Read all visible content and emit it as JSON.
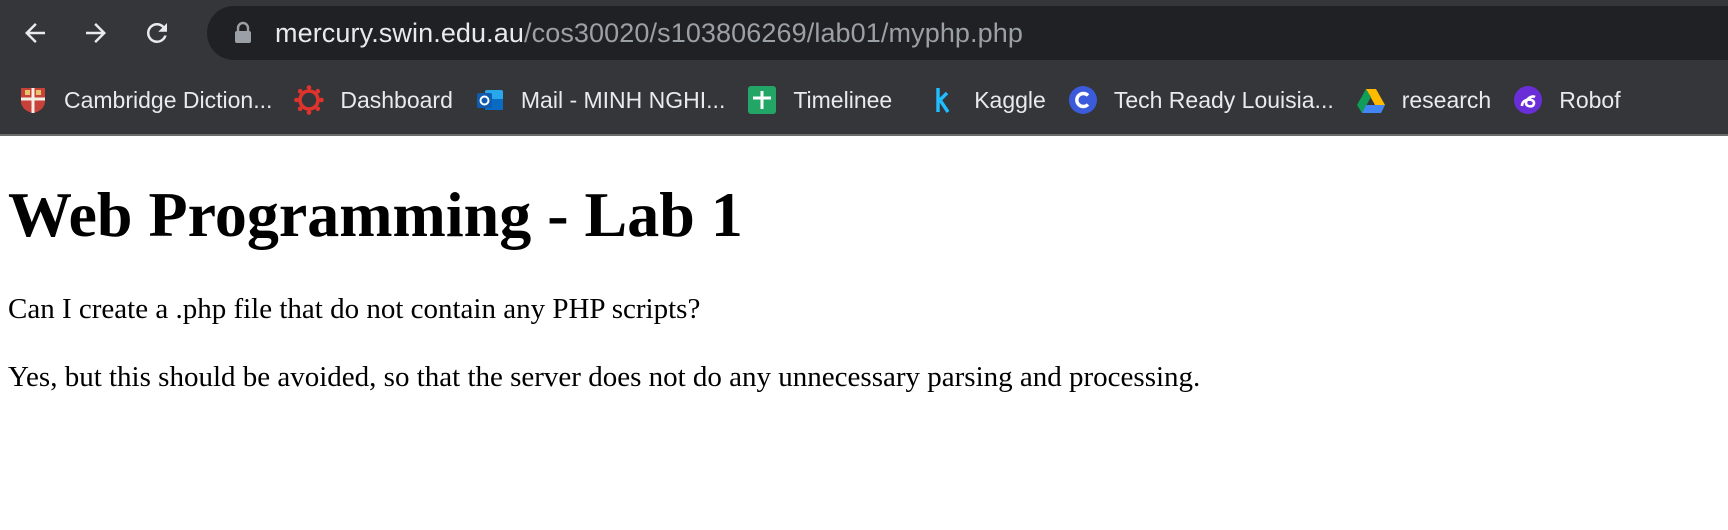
{
  "browser": {
    "url_host": "mercury.swin.edu.au",
    "url_path": "/cos30020/s103806269/lab01/myphp.php"
  },
  "bookmarks": [
    {
      "label": "Cambridge Diction...",
      "icon": "cambridge-crest-icon"
    },
    {
      "label": "Dashboard",
      "icon": "canvas-icon"
    },
    {
      "label": "Mail - MINH NGHI...",
      "icon": "outlook-icon"
    },
    {
      "label": "Timelinee",
      "icon": "google-sheets-icon"
    },
    {
      "label": "Kaggle",
      "icon": "kaggle-icon"
    },
    {
      "label": "Tech Ready Louisia...",
      "icon": "coursera-icon"
    },
    {
      "label": "research",
      "icon": "google-drive-icon"
    },
    {
      "label": "Robof",
      "icon": "roboflow-icon"
    }
  ],
  "page": {
    "heading": "Web Programming - Lab 1",
    "question": "Can I create a .php file that do not contain any PHP scripts?",
    "answer": "Yes, but this should be avoided, so that the server does not do any unnecessary parsing and processing."
  },
  "colors": {
    "chrome_bg": "#35363a",
    "omnibox_bg": "#202124",
    "url_host": "#e8eaed",
    "url_path": "#9aa0a6"
  }
}
